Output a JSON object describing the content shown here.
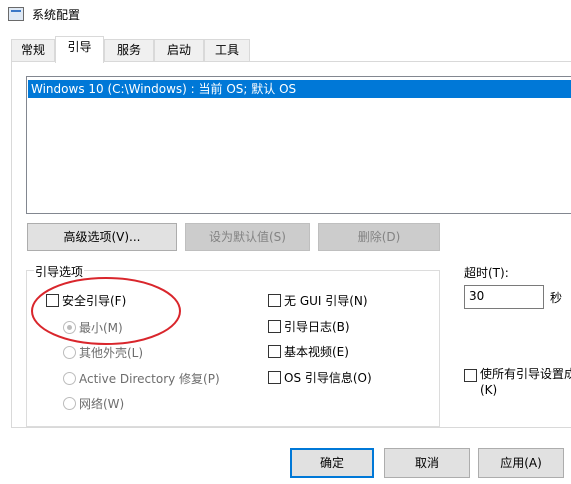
{
  "window": {
    "title": "系统配置",
    "icon": "msconfig-icon"
  },
  "tabs": [
    {
      "label": "常规",
      "active": false
    },
    {
      "label": "引导",
      "active": true
    },
    {
      "label": "服务",
      "active": false
    },
    {
      "label": "启动",
      "active": false
    },
    {
      "label": "工具",
      "active": false
    }
  ],
  "os_list": {
    "items": [
      "Windows 10 (C:\\Windows) : 当前 OS; 默认 OS"
    ],
    "selected_index": 0
  },
  "os_buttons": {
    "advanced": "高级选项(V)...",
    "set_default": "设为默认值(S)",
    "delete": "删除(D)"
  },
  "boot_options": {
    "group_label": "引导选项",
    "safe_boot": {
      "label": "安全引导(F)",
      "checked": false
    },
    "modes": [
      {
        "label": "最小(M)",
        "checked": true,
        "enabled": false
      },
      {
        "label": "其他外壳(L)",
        "checked": false,
        "enabled": false
      },
      {
        "label": "Active Directory 修复(P)",
        "checked": false,
        "enabled": false
      },
      {
        "label": "网络(W)",
        "checked": false,
        "enabled": false
      }
    ],
    "no_gui_boot": {
      "label": "无 GUI 引导(N)",
      "checked": false
    },
    "boot_log": {
      "label": "引导日志(B)",
      "checked": false
    },
    "base_video": {
      "label": "基本视频(E)",
      "checked": false
    },
    "os_boot_info": {
      "label": "OS 引导信息(O)",
      "checked": false
    }
  },
  "timeout": {
    "label": "超时(T):",
    "value": "30",
    "unit": "秒"
  },
  "make_permanent": {
    "label": "使所有引导设置成",
    "label_line2": "(K)",
    "checked": false
  },
  "footer": {
    "ok": "确定",
    "cancel": "取消",
    "apply": "应用(A)"
  },
  "annotation": {
    "shape": "ellipse",
    "color": "#d9262c"
  }
}
